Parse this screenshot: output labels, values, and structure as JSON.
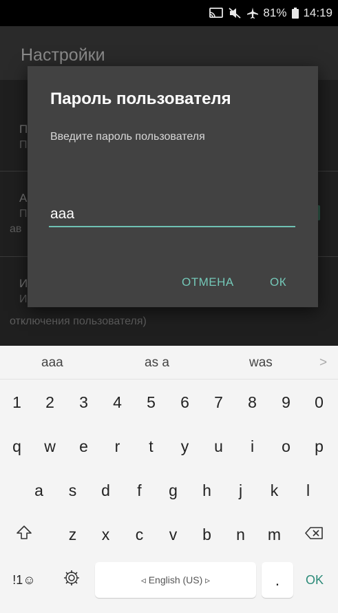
{
  "status_bar": {
    "battery_percent": "81%",
    "time": "14:19",
    "icons": [
      "cast-icon",
      "mute-icon",
      "airplane-icon",
      "battery-icon"
    ]
  },
  "app_bar": {
    "title": "Настройки"
  },
  "background_items": [
    {
      "title": "П",
      "subtitle": "П"
    },
    {
      "title": "А",
      "subtitle": "П",
      "extra": "ав"
    },
    {
      "title": "И",
      "subtitle": "И",
      "extra": "отключения пользователя)"
    }
  ],
  "dialog": {
    "title": "Пароль пользователя",
    "message": "Введите пароль пользователя",
    "input_value": "aaa",
    "cancel_label": "ОТМЕНА",
    "ok_label": "ОК"
  },
  "keyboard": {
    "suggestions": [
      "aaa",
      "as a",
      "was"
    ],
    "suggestion_more": ">",
    "number_row": [
      "1",
      "2",
      "3",
      "4",
      "5",
      "6",
      "7",
      "8",
      "9",
      "0"
    ],
    "row1": [
      "q",
      "w",
      "e",
      "r",
      "t",
      "y",
      "u",
      "i",
      "o",
      "p"
    ],
    "row2": [
      "a",
      "s",
      "d",
      "f",
      "g",
      "h",
      "j",
      "k",
      "l"
    ],
    "row3": [
      "z",
      "x",
      "c",
      "v",
      "b",
      "n",
      "m"
    ],
    "sym_label": "!1☺",
    "space_label": "◃ English (US) ▹",
    "period_label": ".",
    "ok_label": "OK",
    "icons": [
      "shift-icon",
      "backspace-icon",
      "settings-icon"
    ]
  }
}
